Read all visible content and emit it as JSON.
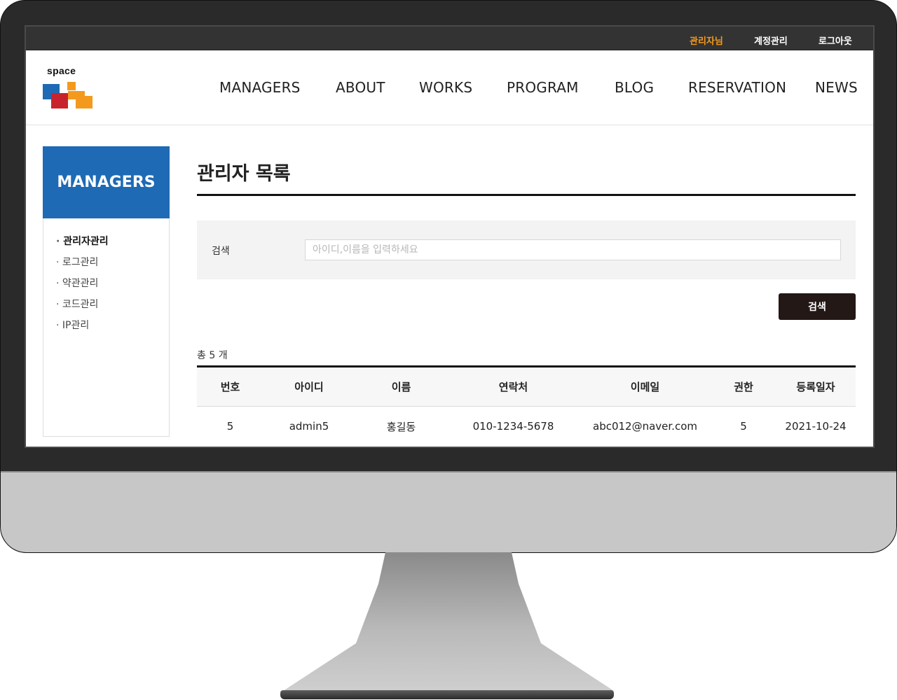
{
  "util_bar": {
    "links": [
      {
        "label": "관리자님",
        "color": "#f39a1e"
      },
      {
        "label": "계정관리"
      },
      {
        "label": "로그아웃"
      }
    ]
  },
  "header": {
    "logo_text": "space",
    "nav": [
      "MANAGERS",
      "ABOUT",
      "WORKS",
      "PROGRAM",
      "BLOG",
      "RESERVATION",
      "NEWS"
    ]
  },
  "sidebar": {
    "title": "MANAGERS",
    "items": [
      {
        "label": "관리자관리",
        "active": true
      },
      {
        "label": "로그관리"
      },
      {
        "label": "약관관리"
      },
      {
        "label": "코드관리"
      },
      {
        "label": "IP관리"
      }
    ]
  },
  "main": {
    "title": "관리자 목록",
    "search": {
      "label": "검색",
      "value": "",
      "placeholder": "아이디,이름을 입력하세요",
      "button": "검색"
    },
    "total": "총 5 개",
    "table": {
      "headers": [
        "번호",
        "아이디",
        "이름",
        "연락처",
        "이메일",
        "권한",
        "등록일자"
      ],
      "rows": [
        [
          "5",
          "admin5",
          "홍길동",
          "010-1234-5678",
          "abc012@naver.com",
          "5",
          "2021-10-24"
        ]
      ]
    }
  },
  "colors": {
    "accent": "#f39a1e",
    "sidebar_head": "#1e6ab5",
    "button": "#231815",
    "logo_blue": "#1e6ab5",
    "logo_red": "#c8232c",
    "logo_orange": "#f39a1e"
  }
}
